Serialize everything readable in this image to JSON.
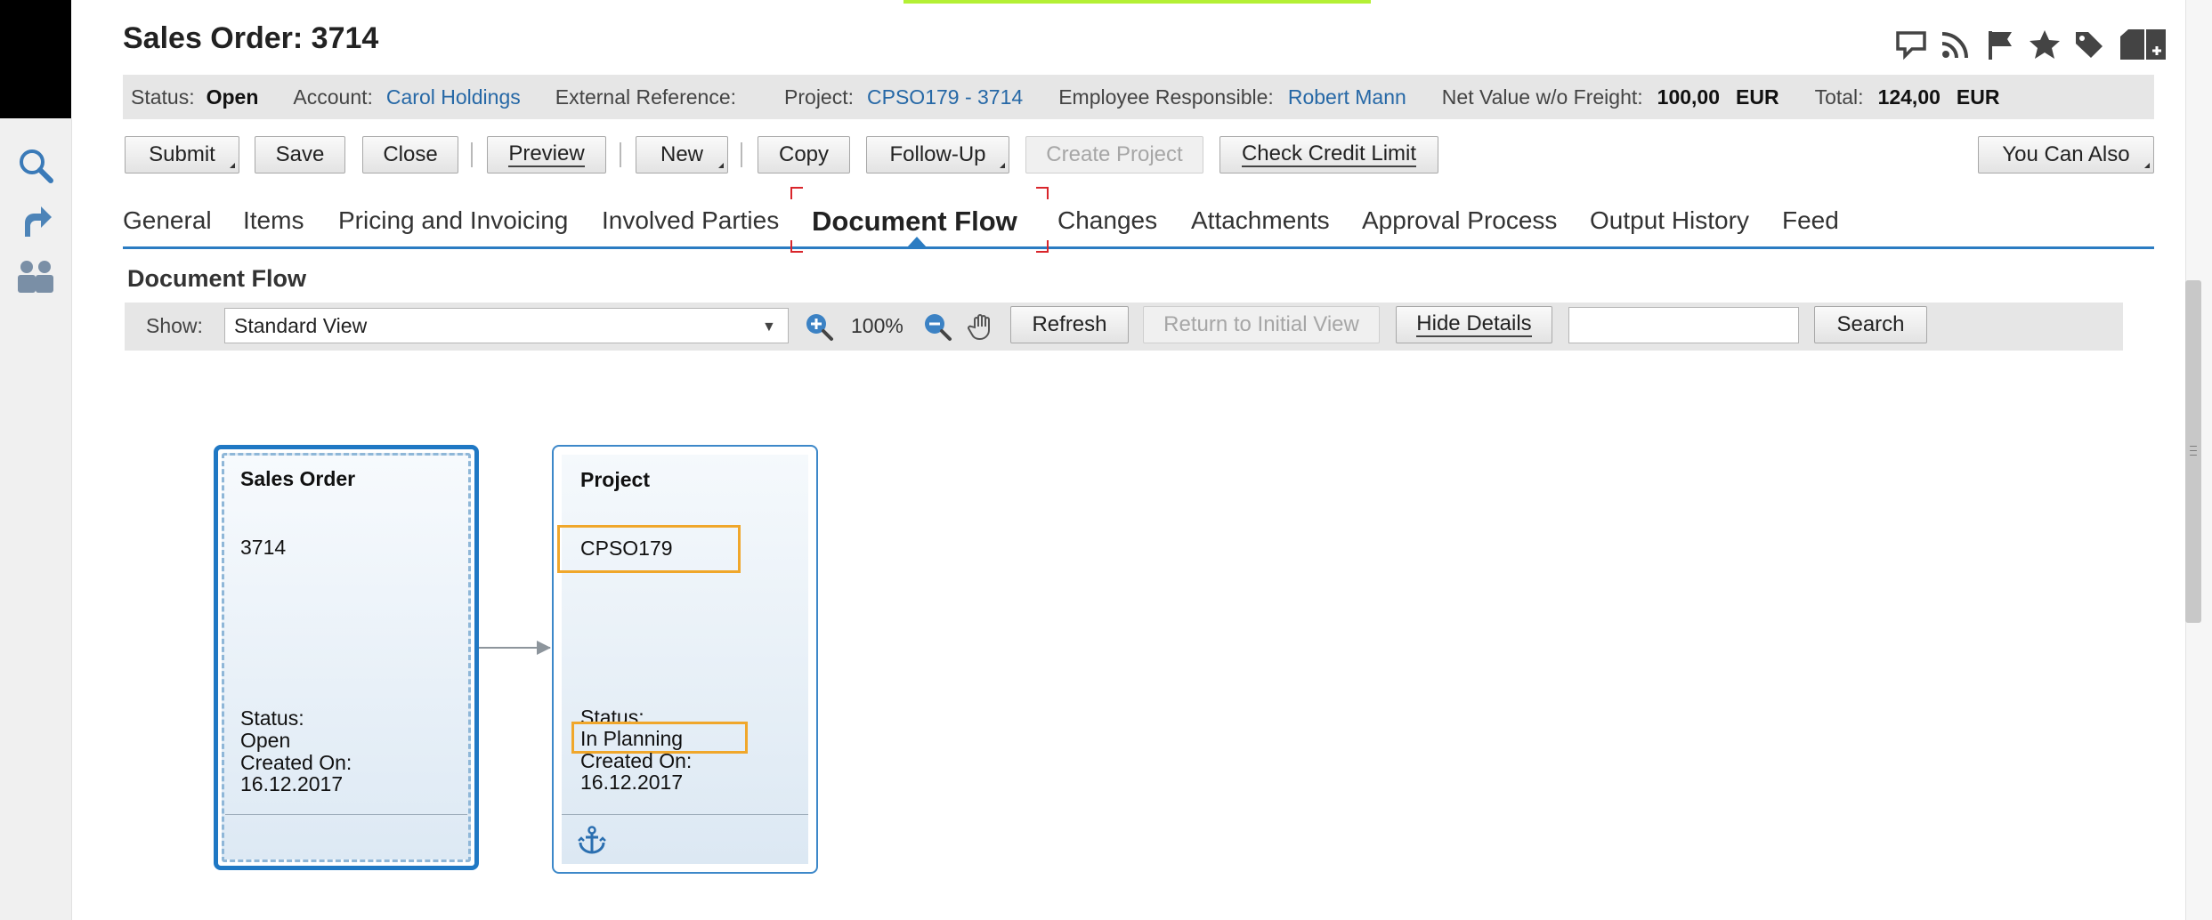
{
  "header": {
    "title": "Sales Order: 3714",
    "icons": [
      "chat-icon",
      "rss-icon",
      "flag-icon",
      "star-icon",
      "tag-icon",
      "new-document-icon"
    ]
  },
  "info": {
    "status_label": "Status:",
    "status_value": "Open",
    "account_label": "Account:",
    "account_value": "Carol Holdings",
    "extref_label": "External Reference:",
    "project_label": "Project:",
    "project_value": "CPSO179 - 3714",
    "employee_label": "Employee Responsible:",
    "employee_value": "Robert Mann",
    "netvalue_label": "Net Value w/o Freight:",
    "netvalue_amount": "100,00",
    "netvalue_currency": "EUR",
    "total_label": "Total:",
    "total_amount": "124,00",
    "total_currency": "EUR"
  },
  "toolbar": {
    "submit": "Submit",
    "save": "Save",
    "close": "Close",
    "preview": "Preview",
    "new": "New",
    "copy": "Copy",
    "follow_up": "Follow-Up",
    "create_project": "Create Project",
    "check_credit_limit": "Check Credit Limit",
    "you_can_also": "You Can Also"
  },
  "tabs": [
    {
      "label": "General"
    },
    {
      "label": "Items"
    },
    {
      "label": "Pricing and Invoicing"
    },
    {
      "label": "Involved Parties"
    },
    {
      "label": "Document Flow"
    },
    {
      "label": "Changes"
    },
    {
      "label": "Attachments"
    },
    {
      "label": "Approval Process"
    },
    {
      "label": "Output History"
    },
    {
      "label": "Feed"
    }
  ],
  "active_tab": "Document Flow",
  "document_flow": {
    "section_title": "Document Flow",
    "show_label": "Show:",
    "view_selected": "Standard View",
    "zoom_level": "100%",
    "refresh": "Refresh",
    "return_initial": "Return to Initial View",
    "hide_details": "Hide Details",
    "search_value": "",
    "search_button": "Search"
  },
  "cards": [
    {
      "title": "Sales Order",
      "id": "3714",
      "status_label": "Status:",
      "status": "Open",
      "created_label": "Created On:",
      "created": "16.12.2017"
    },
    {
      "title": "Project",
      "id": "CPSO179",
      "status_label": "Status:",
      "status": "In Planning",
      "created_label": "Created On:",
      "created": "16.12.2017",
      "footer_icon": "anchor-icon"
    }
  ],
  "colors": {
    "link": "#2668a6",
    "accent": "#2b7cc2",
    "highlight": "#f0a72b",
    "focus": "#d9252b"
  }
}
